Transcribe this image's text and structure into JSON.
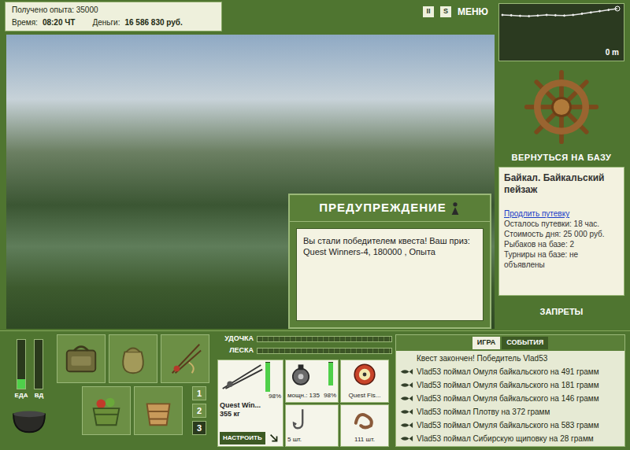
{
  "header": {
    "experience": "Получено опыта: 35000",
    "time_label": "Время:",
    "time": "08:20 ЧТ",
    "money_label": "Деньги:",
    "money": "16 586 830 руб."
  },
  "toolbar": [
    "II",
    "S",
    "МЕНЮ"
  ],
  "depth": {
    "values": [
      2.0,
      2.1,
      2.3,
      2.4,
      2.2,
      2.0,
      2.1,
      2.2,
      2.0,
      1.6,
      1.2,
      0.8,
      0.4,
      0
    ],
    "reading": "0 m"
  },
  "location": {
    "return_button": "ВЕРНУТЬСЯ НА БАЗУ",
    "title": "Байкал. Байкальский пейзаж",
    "extend_link": "Продлить путевку",
    "details": [
      "Осталось путевки: 18 час.",
      "Стоимость дня: 25 000 руб.",
      "Рыбаков на базе: 2",
      "Турниры на базе: не объявлены"
    ],
    "bans_button": "ЗАПРЕТЫ"
  },
  "dialog": {
    "title": "ПРЕДУПРЕЖДЕНИЕ",
    "message": "Вы стали победителем квеста! Ваш приз: Quest Winners-4, 180000 , Опыта"
  },
  "needs": [
    {
      "label": "ЕДА",
      "level": 0.2
    },
    {
      "label": "ВД",
      "level": 0
    }
  ],
  "inventory_pages": [
    {
      "label": "1",
      "selected": false
    },
    {
      "label": "2",
      "selected": false
    },
    {
      "label": "3",
      "selected": true
    }
  ],
  "tackle": {
    "gauges": [
      {
        "label": "УДОЧКА",
        "level": 0
      },
      {
        "label": "ЛЕСКА",
        "level": 0
      }
    ],
    "rod": {
      "name": "Quest Win...",
      "load": "355 кг",
      "condition": "98%",
      "level": 0.98,
      "button": "НАСТРОИТЬ"
    },
    "reel": {
      "power": "мощн.: 135",
      "condition": "98%",
      "level": 0.98
    },
    "line": {
      "name": "Quest Fis..."
    },
    "hook": {
      "count": "5 шт."
    },
    "bait": {
      "count": "111 шт."
    }
  },
  "events": {
    "tabs": [
      {
        "label": "ИГРА",
        "selected": true
      },
      {
        "label": "СОБЫТИЯ",
        "selected": false
      }
    ],
    "messages": [
      {
        "text": "Квест закончен! Победитель Vlad53",
        "kind": "notice"
      },
      {
        "text": "Vlad53 поймал Омуля байкальского на 491 грамм",
        "kind": "catch"
      },
      {
        "text": "Vlad53 поймал Омуля байкальского на 181 грамм",
        "kind": "catch"
      },
      {
        "text": "Vlad53 поймал Омуля байкальского на 146 грамм",
        "kind": "catch"
      },
      {
        "text": "Vlad53 поймал Плотву на 372 грамм",
        "kind": "catch"
      },
      {
        "text": "Vlad53 поймал Омуля байкальского на 583 грамм",
        "kind": "catch"
      },
      {
        "text": "Vlad53 поймал Сибирскую щиповку на 28 грамм",
        "kind": "catch"
      }
    ]
  }
}
